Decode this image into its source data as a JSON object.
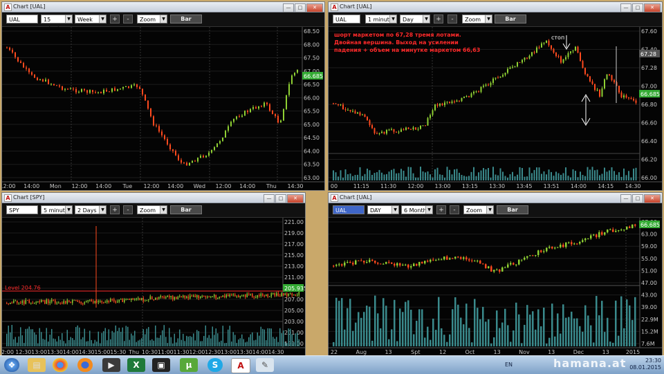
{
  "colors": {
    "up": "#8fd033",
    "down": "#ff4a1e",
    "volume": "#3a8a8c",
    "level": "#ff2a2a",
    "price_badge": "#33aa33",
    "desktop": "#c9a86a"
  },
  "windows": [
    {
      "id": "w1",
      "title": "Chart [UAL]",
      "toolbar": {
        "symbol": "UAL",
        "interval": "15 minutes",
        "period": "Week",
        "plus": "+",
        "minus": "-",
        "zoom": "Zoom",
        "mode": "Bar"
      },
      "y_ticks": [
        "68.50",
        "68.00",
        "67.50",
        "67.00",
        "66.50",
        "66.00",
        "65.50",
        "65.00",
        "64.50",
        "64.00",
        "63.50",
        "63.00"
      ],
      "x_ticks": [
        "12:00",
        "14:00",
        "Mon",
        "12:00",
        "14:00",
        "Tue",
        "12:00",
        "14:00",
        "Wed",
        "12:00",
        "14:00",
        "Thu",
        "14:30"
      ],
      "price_badge": "66.685"
    },
    {
      "id": "w2",
      "title": "Chart [UAL]",
      "toolbar": {
        "symbol": "UAL",
        "interval": "1 minute",
        "period": "Day",
        "plus": "+",
        "minus": "-",
        "zoom": "Zoom",
        "mode": "Bar"
      },
      "annotation": "шорт маркетом по 67,28 тремя лотами. Двойная вершина. Выход на усилении падения + объем на минутке маркетом 66,63",
      "stop_label": "стоп",
      "y_ticks": [
        "67.60",
        "67.40",
        "67.28",
        "67.00",
        "66.80",
        "66.60",
        "66.40",
        "66.20",
        "66.00"
      ],
      "x_ticks": [
        "00",
        "11:15",
        "11:30",
        "12:00",
        "13:00",
        "13:15",
        "13:30",
        "13:45",
        "13:51",
        "14:00",
        "14:15",
        "14:30"
      ],
      "price_badge": "66.685",
      "entry_badge": "67.28"
    },
    {
      "id": "w3",
      "title": "Chart [SPY]",
      "toolbar": {
        "symbol": "SPY",
        "interval": "5 minutes",
        "period": "2 Days",
        "plus": "+",
        "minus": "-",
        "zoom": "Zoom",
        "mode": "Bar"
      },
      "level_label": "Level 204.76",
      "y_ticks": [
        "221.00",
        "219.00",
        "217.00",
        "215.00",
        "213.00",
        "211.00",
        "209.00",
        "207.00",
        "205.00",
        "203.00",
        "201.00",
        "199.00"
      ],
      "x_ticks": [
        "2:00",
        "12:30",
        "13:00",
        "13:30",
        "14:00",
        "14:30",
        "15:00",
        "15:30",
        "Thu",
        "10:30",
        "11:00",
        "11:30",
        "12:00",
        "12:30",
        "13:00",
        "13:30",
        "14:00",
        "14:30"
      ],
      "price_badge": "205.935"
    },
    {
      "id": "w4",
      "title": "Chart [UAL]",
      "toolbar": {
        "symbol": "UAL",
        "interval": "DAY",
        "period": "6 Months",
        "plus": "+",
        "minus": "-",
        "zoom": "Zoom",
        "mode": "Bar"
      },
      "y_ticks": [
        "67.00",
        "63.00",
        "59.00",
        "55.00",
        "51.00",
        "47.00",
        "43.00",
        "39.00"
      ],
      "vol_ticks": [
        "22.9M",
        "15.2M",
        "7.6M"
      ],
      "x_ticks": [
        "22",
        "Aug",
        "13",
        "Spt",
        "12",
        "Oct",
        "13",
        "Nov",
        "13",
        "Dec",
        "13",
        "2015"
      ],
      "price_badge": "66.685"
    }
  ],
  "taskbar": {
    "apps": [
      "start",
      "file-explorer",
      "chrome",
      "firefox",
      "media-player",
      "excel",
      "video-app",
      "utorrent",
      "skype",
      "chart-app",
      "paint"
    ],
    "lang": "EN",
    "clock_time": "23:30",
    "clock_date": "08.01.2015"
  },
  "watermark": "hamana.at"
}
